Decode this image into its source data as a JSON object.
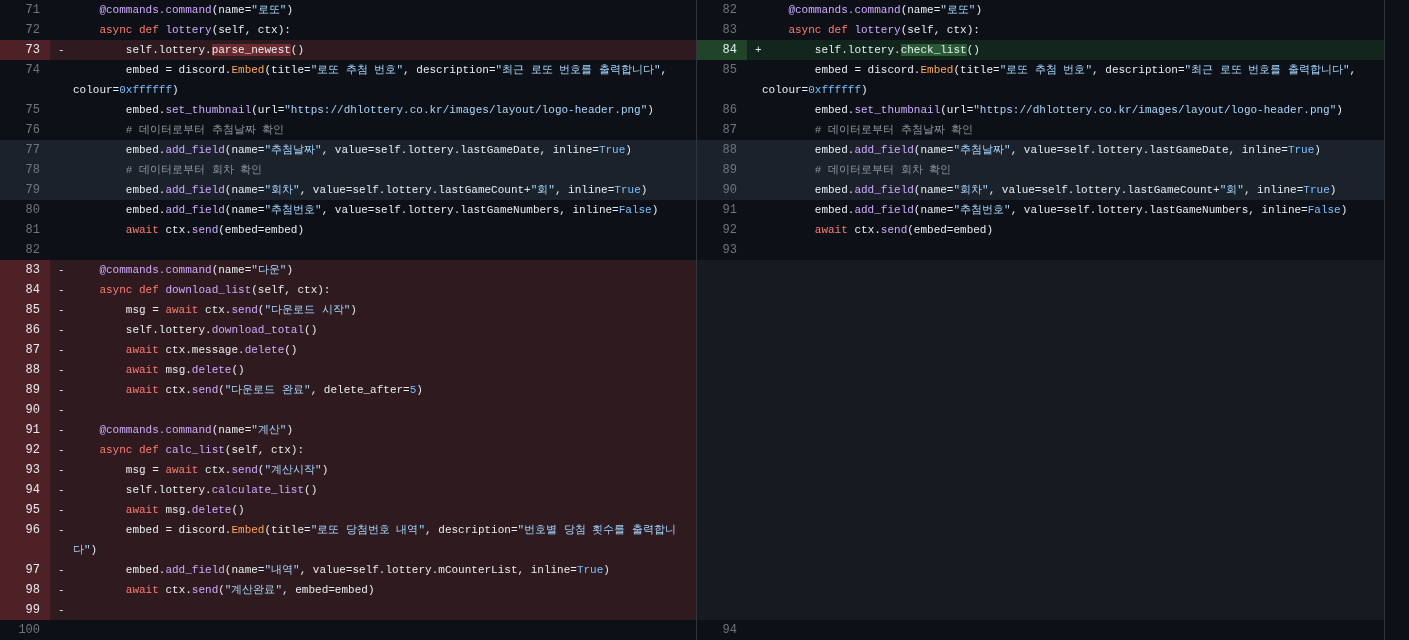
{
  "rows": [
    {
      "highlighted": false,
      "left": {
        "kind": "context",
        "number": "71",
        "tokens": [
          {
            "kind": "fn",
            "t": "    @commands.command"
          },
          {
            "kind": "p",
            "t": "(name="
          },
          {
            "kind": "str",
            "t": "\"로또\""
          },
          {
            "kind": "p",
            "t": ")"
          }
        ]
      },
      "right": {
        "kind": "context",
        "number": "82",
        "tokens": [
          {
            "kind": "fn",
            "t": "    @commands.command"
          },
          {
            "kind": "p",
            "t": "(name="
          },
          {
            "kind": "str",
            "t": "\"로또\""
          },
          {
            "kind": "p",
            "t": ")"
          }
        ]
      }
    },
    {
      "highlighted": false,
      "left": {
        "kind": "context",
        "number": "72",
        "tokens": [
          {
            "kind": "kw",
            "t": "    async def "
          },
          {
            "kind": "fn",
            "t": "lottery"
          },
          {
            "kind": "p",
            "t": "(self, ctx):"
          }
        ]
      },
      "right": {
        "kind": "context",
        "number": "83",
        "tokens": [
          {
            "kind": "kw",
            "t": "    async def "
          },
          {
            "kind": "fn",
            "t": "lottery"
          },
          {
            "kind": "p",
            "t": "(self, ctx):"
          }
        ]
      }
    },
    {
      "left": {
        "kind": "deleted",
        "number": "73",
        "marker": "-",
        "tokens": [
          {
            "kind": "p",
            "t": "        self.lottery."
          },
          {
            "kind": "del",
            "t": "parse_newest"
          },
          {
            "kind": "p",
            "t": "()"
          }
        ]
      },
      "right": {
        "kind": "added",
        "number": "84",
        "marker": "+",
        "tokens": [
          {
            "kind": "p",
            "t": "        self.lottery."
          },
          {
            "kind": "add",
            "t": "check_list"
          },
          {
            "kind": "p",
            "t": "()"
          }
        ]
      }
    },
    {
      "highlighted": false,
      "left": {
        "kind": "context",
        "number": "74",
        "tokens": [
          {
            "kind": "p",
            "t": "        embed = discord."
          },
          {
            "kind": "cls",
            "t": "Embed"
          },
          {
            "kind": "p",
            "t": "(title="
          },
          {
            "kind": "str",
            "t": "\"로또 추첨 번호\""
          },
          {
            "kind": "p",
            "t": ", description="
          },
          {
            "kind": "str",
            "t": "\"최근 로또 번호를 출력합니다\""
          },
          {
            "kind": "p",
            "t": ", colour="
          },
          {
            "kind": "num",
            "t": "0xffffff"
          },
          {
            "kind": "p",
            "t": ")"
          }
        ]
      },
      "right": {
        "kind": "context",
        "number": "85",
        "tokens": [
          {
            "kind": "p",
            "t": "        embed = discord."
          },
          {
            "kind": "cls",
            "t": "Embed"
          },
          {
            "kind": "p",
            "t": "(title="
          },
          {
            "kind": "str",
            "t": "\"로또 추첨 번호\""
          },
          {
            "kind": "p",
            "t": ", description="
          },
          {
            "kind": "str",
            "t": "\"최근 로또 번호를 출력합니다\""
          },
          {
            "kind": "p",
            "t": ", colour="
          },
          {
            "kind": "num",
            "t": "0xffffff"
          },
          {
            "kind": "p",
            "t": ")"
          }
        ]
      }
    },
    {
      "highlighted": false,
      "left": {
        "kind": "context",
        "number": "75",
        "tokens": [
          {
            "kind": "p",
            "t": "        embed."
          },
          {
            "kind": "fn",
            "t": "set_thumbnail"
          },
          {
            "kind": "p",
            "t": "(url="
          },
          {
            "kind": "str",
            "t": "\"https://dhlottery.co.kr/images/layout/logo-header.png\""
          },
          {
            "kind": "p",
            "t": ")"
          }
        ]
      },
      "right": {
        "kind": "context",
        "number": "86",
        "tokens": [
          {
            "kind": "p",
            "t": "        embed."
          },
          {
            "kind": "fn",
            "t": "set_thumbnail"
          },
          {
            "kind": "p",
            "t": "(url="
          },
          {
            "kind": "str",
            "t": "\"https://dhlottery.co.kr/images/layout/logo-header.png\""
          },
          {
            "kind": "p",
            "t": ")"
          }
        ]
      }
    },
    {
      "highlighted": false,
      "left": {
        "kind": "context",
        "number": "76",
        "tokens": [
          {
            "kind": "cm",
            "t": "        # 데이터로부터 추첨날짜 확인"
          }
        ]
      },
      "right": {
        "kind": "context",
        "number": "87",
        "tokens": [
          {
            "kind": "cm",
            "t": "        # 데이터로부터 추첨날짜 확인"
          }
        ]
      }
    },
    {
      "highlighted": true,
      "left": {
        "kind": "context",
        "number": "77",
        "tokens": [
          {
            "kind": "p",
            "t": "        embed."
          },
          {
            "kind": "fn",
            "t": "add_field"
          },
          {
            "kind": "p",
            "t": "(name="
          },
          {
            "kind": "str",
            "t": "\"추첨날짜\""
          },
          {
            "kind": "p",
            "t": ", value=self.lottery.lastGameDate, inline="
          },
          {
            "kind": "num",
            "t": "True"
          },
          {
            "kind": "p",
            "t": ")"
          }
        ]
      },
      "right": {
        "kind": "context",
        "number": "88",
        "tokens": [
          {
            "kind": "p",
            "t": "        embed."
          },
          {
            "kind": "fn",
            "t": "add_field"
          },
          {
            "kind": "p",
            "t": "(name="
          },
          {
            "kind": "str",
            "t": "\"추첨날짜\""
          },
          {
            "kind": "p",
            "t": ", value=self.lottery.lastGameDate, inline="
          },
          {
            "kind": "num",
            "t": "True"
          },
          {
            "kind": "p",
            "t": ")"
          }
        ]
      }
    },
    {
      "highlighted": true,
      "left": {
        "kind": "context",
        "number": "78",
        "tokens": [
          {
            "kind": "cm",
            "t": "        # 데이터로부터 회차 확인"
          }
        ]
      },
      "right": {
        "kind": "context",
        "number": "89",
        "tokens": [
          {
            "kind": "cm",
            "t": "        # 데이터로부터 회차 확인"
          }
        ]
      }
    },
    {
      "highlighted": true,
      "left": {
        "kind": "context",
        "number": "79",
        "tokens": [
          {
            "kind": "p",
            "t": "        embed."
          },
          {
            "kind": "fn",
            "t": "add_field"
          },
          {
            "kind": "p",
            "t": "(name="
          },
          {
            "kind": "str",
            "t": "\"회차\""
          },
          {
            "kind": "p",
            "t": ", value=self.lottery.lastGameCount+"
          },
          {
            "kind": "str",
            "t": "\"회\""
          },
          {
            "kind": "p",
            "t": ", inline="
          },
          {
            "kind": "num",
            "t": "True"
          },
          {
            "kind": "p",
            "t": ")"
          }
        ]
      },
      "right": {
        "kind": "context",
        "number": "90",
        "tokens": [
          {
            "kind": "p",
            "t": "        embed."
          },
          {
            "kind": "fn",
            "t": "add_field"
          },
          {
            "kind": "p",
            "t": "(name="
          },
          {
            "kind": "str",
            "t": "\"회차\""
          },
          {
            "kind": "p",
            "t": ", value=self.lottery.lastGameCount+"
          },
          {
            "kind": "str",
            "t": "\"회\""
          },
          {
            "kind": "p",
            "t": ", inline="
          },
          {
            "kind": "num",
            "t": "True"
          },
          {
            "kind": "p",
            "t": ")"
          }
        ]
      }
    },
    {
      "highlighted": false,
      "left": {
        "kind": "context",
        "number": "80",
        "tokens": [
          {
            "kind": "p",
            "t": "        embed."
          },
          {
            "kind": "fn",
            "t": "add_field"
          },
          {
            "kind": "p",
            "t": "(name="
          },
          {
            "kind": "str",
            "t": "\"추첨번호\""
          },
          {
            "kind": "p",
            "t": ", value=self.lottery.lastGameNumbers, inline="
          },
          {
            "kind": "num",
            "t": "False"
          },
          {
            "kind": "p",
            "t": ")"
          }
        ]
      },
      "right": {
        "kind": "context",
        "number": "91",
        "tokens": [
          {
            "kind": "p",
            "t": "        embed."
          },
          {
            "kind": "fn",
            "t": "add_field"
          },
          {
            "kind": "p",
            "t": "(name="
          },
          {
            "kind": "str",
            "t": "\"추첨번호\""
          },
          {
            "kind": "p",
            "t": ", value=self.lottery.lastGameNumbers, inline="
          },
          {
            "kind": "num",
            "t": "False"
          },
          {
            "kind": "p",
            "t": ")"
          }
        ]
      }
    },
    {
      "highlighted": false,
      "left": {
        "kind": "context",
        "number": "81",
        "tokens": [
          {
            "kind": "kw",
            "t": "        await"
          },
          {
            "kind": "p",
            "t": " ctx."
          },
          {
            "kind": "fn",
            "t": "send"
          },
          {
            "kind": "p",
            "t": "(embed=embed)"
          }
        ]
      },
      "right": {
        "kind": "context",
        "number": "92",
        "tokens": [
          {
            "kind": "kw",
            "t": "        await"
          },
          {
            "kind": "p",
            "t": " ctx."
          },
          {
            "kind": "fn",
            "t": "send"
          },
          {
            "kind": "p",
            "t": "(embed=embed)"
          }
        ]
      }
    },
    {
      "highlighted": false,
      "left": {
        "kind": "context",
        "number": "82"
      },
      "right": {
        "kind": "context",
        "number": "93"
      }
    },
    {
      "left": {
        "kind": "deleted",
        "number": "83",
        "marker": "-",
        "tokens": [
          {
            "kind": "fn",
            "t": "    @commands.command"
          },
          {
            "kind": "p",
            "t": "(name="
          },
          {
            "kind": "str",
            "t": "\"다운\""
          },
          {
            "kind": "p",
            "t": ")"
          }
        ]
      },
      "right": {
        "kind": "empty"
      }
    },
    {
      "left": {
        "kind": "deleted",
        "number": "84",
        "marker": "-",
        "tokens": [
          {
            "kind": "kw",
            "t": "    async def "
          },
          {
            "kind": "fn",
            "t": "download_list"
          },
          {
            "kind": "p",
            "t": "(self, ctx):"
          }
        ]
      },
      "right": {
        "kind": "empty"
      }
    },
    {
      "left": {
        "kind": "deleted",
        "number": "85",
        "marker": "-",
        "tokens": [
          {
            "kind": "p",
            "t": "        msg = "
          },
          {
            "kind": "kw",
            "t": "await"
          },
          {
            "kind": "p",
            "t": " ctx."
          },
          {
            "kind": "fn",
            "t": "send"
          },
          {
            "kind": "p",
            "t": "("
          },
          {
            "kind": "str",
            "t": "\"다운로드 시작\""
          },
          {
            "kind": "p",
            "t": ")"
          }
        ]
      },
      "right": {
        "kind": "empty"
      }
    },
    {
      "left": {
        "kind": "deleted",
        "number": "86",
        "marker": "-",
        "tokens": [
          {
            "kind": "p",
            "t": "        self.lottery."
          },
          {
            "kind": "fn",
            "t": "download_total"
          },
          {
            "kind": "p",
            "t": "()"
          }
        ]
      },
      "right": {
        "kind": "empty"
      }
    },
    {
      "left": {
        "kind": "deleted",
        "number": "87",
        "marker": "-",
        "tokens": [
          {
            "kind": "kw",
            "t": "        await"
          },
          {
            "kind": "p",
            "t": " ctx.message."
          },
          {
            "kind": "fn",
            "t": "delete"
          },
          {
            "kind": "p",
            "t": "()"
          }
        ]
      },
      "right": {
        "kind": "empty"
      }
    },
    {
      "left": {
        "kind": "deleted",
        "number": "88",
        "marker": "-",
        "tokens": [
          {
            "kind": "kw",
            "t": "        await"
          },
          {
            "kind": "p",
            "t": " msg."
          },
          {
            "kind": "fn",
            "t": "delete"
          },
          {
            "kind": "p",
            "t": "()"
          }
        ]
      },
      "right": {
        "kind": "empty"
      }
    },
    {
      "left": {
        "kind": "deleted",
        "number": "89",
        "marker": "-",
        "tokens": [
          {
            "kind": "kw",
            "t": "        await"
          },
          {
            "kind": "p",
            "t": " ctx."
          },
          {
            "kind": "fn",
            "t": "send"
          },
          {
            "kind": "p",
            "t": "("
          },
          {
            "kind": "str",
            "t": "\"다운로드 완료\""
          },
          {
            "kind": "p",
            "t": ", delete_after="
          },
          {
            "kind": "num",
            "t": "5"
          },
          {
            "kind": "p",
            "t": ")"
          }
        ]
      },
      "right": {
        "kind": "empty"
      }
    },
    {
      "left": {
        "kind": "deleted",
        "number": "90",
        "marker": "-"
      },
      "right": {
        "kind": "empty"
      }
    },
    {
      "left": {
        "kind": "deleted",
        "number": "91",
        "marker": "-",
        "tokens": [
          {
            "kind": "fn",
            "t": "    @commands.command"
          },
          {
            "kind": "p",
            "t": "(name="
          },
          {
            "kind": "str",
            "t": "\"계산\""
          },
          {
            "kind": "p",
            "t": ")"
          }
        ]
      },
      "right": {
        "kind": "empty"
      }
    },
    {
      "left": {
        "kind": "deleted",
        "number": "92",
        "marker": "-",
        "tokens": [
          {
            "kind": "kw",
            "t": "    async def "
          },
          {
            "kind": "fn",
            "t": "calc_list"
          },
          {
            "kind": "p",
            "t": "(self, ctx):"
          }
        ]
      },
      "right": {
        "kind": "empty"
      }
    },
    {
      "left": {
        "kind": "deleted",
        "number": "93",
        "marker": "-",
        "tokens": [
          {
            "kind": "p",
            "t": "        msg = "
          },
          {
            "kind": "kw",
            "t": "await"
          },
          {
            "kind": "p",
            "t": " ctx."
          },
          {
            "kind": "fn",
            "t": "send"
          },
          {
            "kind": "p",
            "t": "("
          },
          {
            "kind": "str",
            "t": "\"계산시작\""
          },
          {
            "kind": "p",
            "t": ")"
          }
        ]
      },
      "right": {
        "kind": "empty"
      }
    },
    {
      "left": {
        "kind": "deleted",
        "number": "94",
        "marker": "-",
        "tokens": [
          {
            "kind": "p",
            "t": "        self.lottery."
          },
          {
            "kind": "fn",
            "t": "calculate_list"
          },
          {
            "kind": "p",
            "t": "()"
          }
        ]
      },
      "right": {
        "kind": "empty"
      }
    },
    {
      "left": {
        "kind": "deleted",
        "number": "95",
        "marker": "-",
        "tokens": [
          {
            "kind": "kw",
            "t": "        await"
          },
          {
            "kind": "p",
            "t": " msg."
          },
          {
            "kind": "fn",
            "t": "delete"
          },
          {
            "kind": "p",
            "t": "()"
          }
        ]
      },
      "right": {
        "kind": "empty"
      }
    },
    {
      "left": {
        "kind": "deleted",
        "number": "96",
        "marker": "-",
        "tokens": [
          {
            "kind": "p",
            "t": "        embed = discord."
          },
          {
            "kind": "cls",
            "t": "Embed"
          },
          {
            "kind": "p",
            "t": "(title="
          },
          {
            "kind": "str",
            "t": "\"로또 당첨번호 내역\""
          },
          {
            "kind": "p",
            "t": ", description="
          },
          {
            "kind": "str",
            "t": "\"번호별 당첨 횟수를 출력합니다\""
          },
          {
            "kind": "p",
            "t": ")"
          }
        ]
      },
      "right": {
        "kind": "empty"
      }
    },
    {
      "left": {
        "kind": "deleted",
        "number": "97",
        "marker": "-",
        "tokens": [
          {
            "kind": "p",
            "t": "        embed."
          },
          {
            "kind": "fn",
            "t": "add_field"
          },
          {
            "kind": "p",
            "t": "(name="
          },
          {
            "kind": "str",
            "t": "\"내역\""
          },
          {
            "kind": "p",
            "t": ", value=self.lottery.mCounterList, inline="
          },
          {
            "kind": "num",
            "t": "True"
          },
          {
            "kind": "p",
            "t": ")"
          }
        ]
      },
      "right": {
        "kind": "empty"
      }
    },
    {
      "left": {
        "kind": "deleted",
        "number": "98",
        "marker": "-",
        "tokens": [
          {
            "kind": "kw",
            "t": "        await"
          },
          {
            "kind": "p",
            "t": " ctx."
          },
          {
            "kind": "fn",
            "t": "send"
          },
          {
            "kind": "p",
            "t": "("
          },
          {
            "kind": "str",
            "t": "\"계산완료\""
          },
          {
            "kind": "p",
            "t": ", embed=embed)"
          }
        ]
      },
      "right": {
        "kind": "empty"
      }
    },
    {
      "left": {
        "kind": "deleted",
        "number": "99",
        "marker": "-"
      },
      "right": {
        "kind": "empty"
      }
    },
    {
      "highlighted": false,
      "left": {
        "kind": "context",
        "number": "100"
      },
      "right": {
        "kind": "context",
        "number": "94"
      }
    }
  ]
}
